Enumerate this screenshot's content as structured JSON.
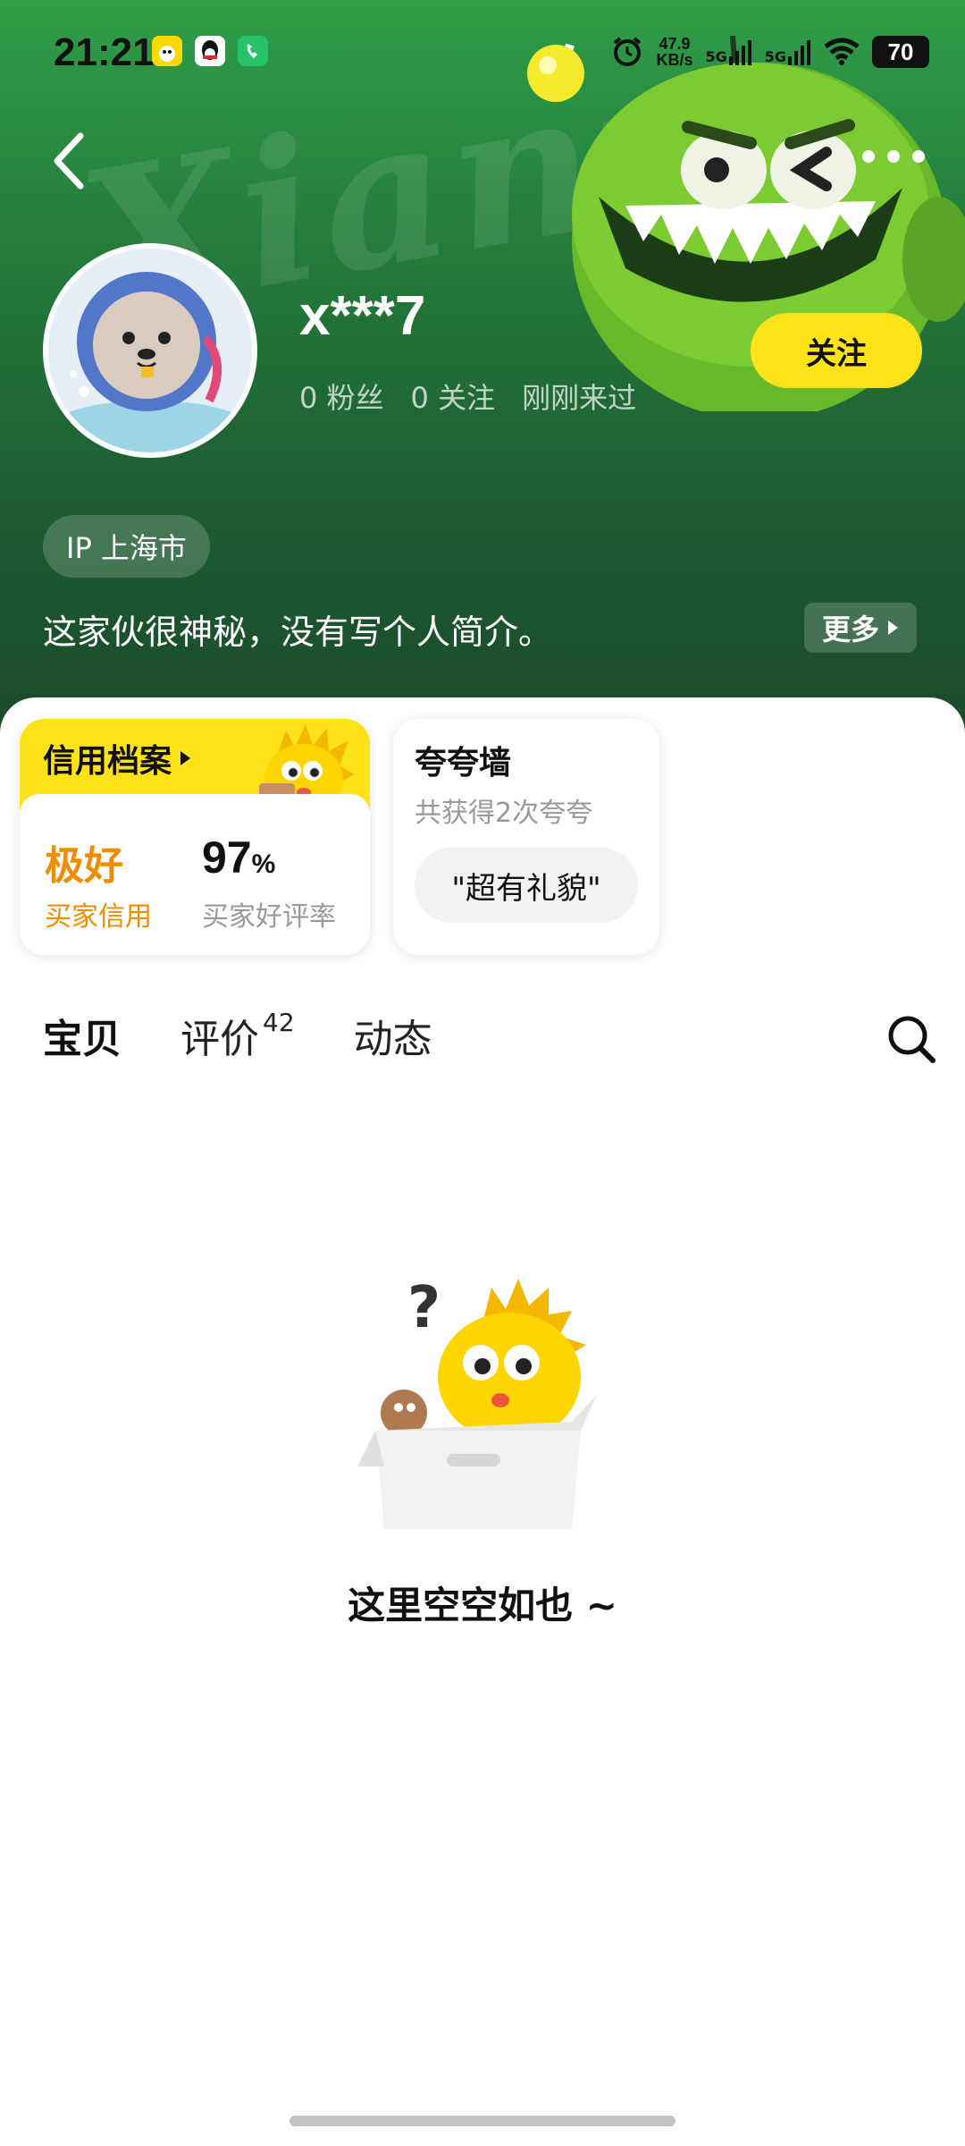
{
  "status_bar": {
    "time": "21:21",
    "net_speed_value": "47.9",
    "net_speed_unit": "KB/s",
    "signal_1": "5G",
    "signal_2": "5G",
    "battery": "70"
  },
  "header": {
    "bg_text": "Xianyu",
    "more_dots": "•••"
  },
  "profile": {
    "username": "x***7",
    "fans": "0 粉丝",
    "following": "0 关注",
    "last_seen": "刚刚来过",
    "follow_label": "关注",
    "ip_location": "IP 上海市",
    "bio": "这家伙很神秘，没有写个人简介。",
    "more_label": "更多"
  },
  "credit": {
    "title": "信用档案",
    "level": "极好",
    "level_label": "买家信用",
    "rate_value": "97",
    "rate_unit": "%",
    "rate_label": "买家好评率"
  },
  "praise": {
    "title": "夸夸墙",
    "subtitle": "共获得2次夸夸",
    "tag": "\"超有礼貌\""
  },
  "tabs": [
    {
      "label": "宝贝",
      "badge": ""
    },
    {
      "label": "评价",
      "badge": "42"
    },
    {
      "label": "动态",
      "badge": ""
    }
  ],
  "empty_state": {
    "message": "这里空空如也 ~"
  },
  "colors": {
    "accent_yellow": "#ffe21a",
    "header_green": "#247a3b",
    "credit_orange": "#f08c00"
  }
}
